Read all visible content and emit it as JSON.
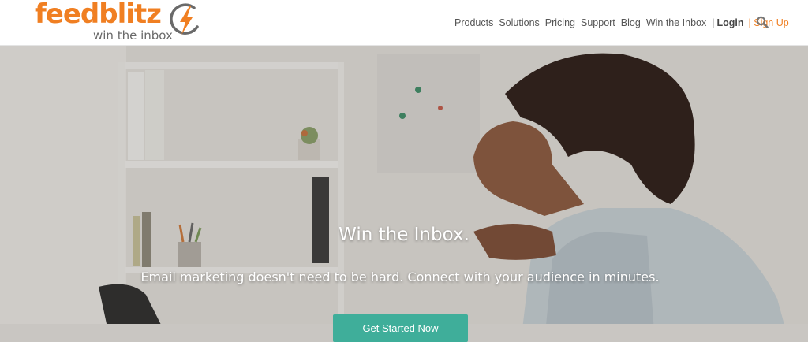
{
  "header": {
    "logo": {
      "word": "feedblitz",
      "tagline": "win the inbox"
    },
    "nav": {
      "items": [
        "Products",
        "Solutions",
        "Pricing",
        "Support",
        "Blog",
        "Win the Inbox"
      ],
      "separator": "|",
      "login": "Login",
      "signup": "| Sign Up",
      "search_icon": "search-icon"
    }
  },
  "hero": {
    "title": "Win the Inbox.",
    "subtitle": "Email marketing doesn't need to be hard. Connect with your audience in minutes.",
    "cta": "Get Started Now"
  },
  "colors": {
    "brand_orange": "#f07f22",
    "cta_green": "#3fae9a",
    "nav_text": "#555555"
  }
}
